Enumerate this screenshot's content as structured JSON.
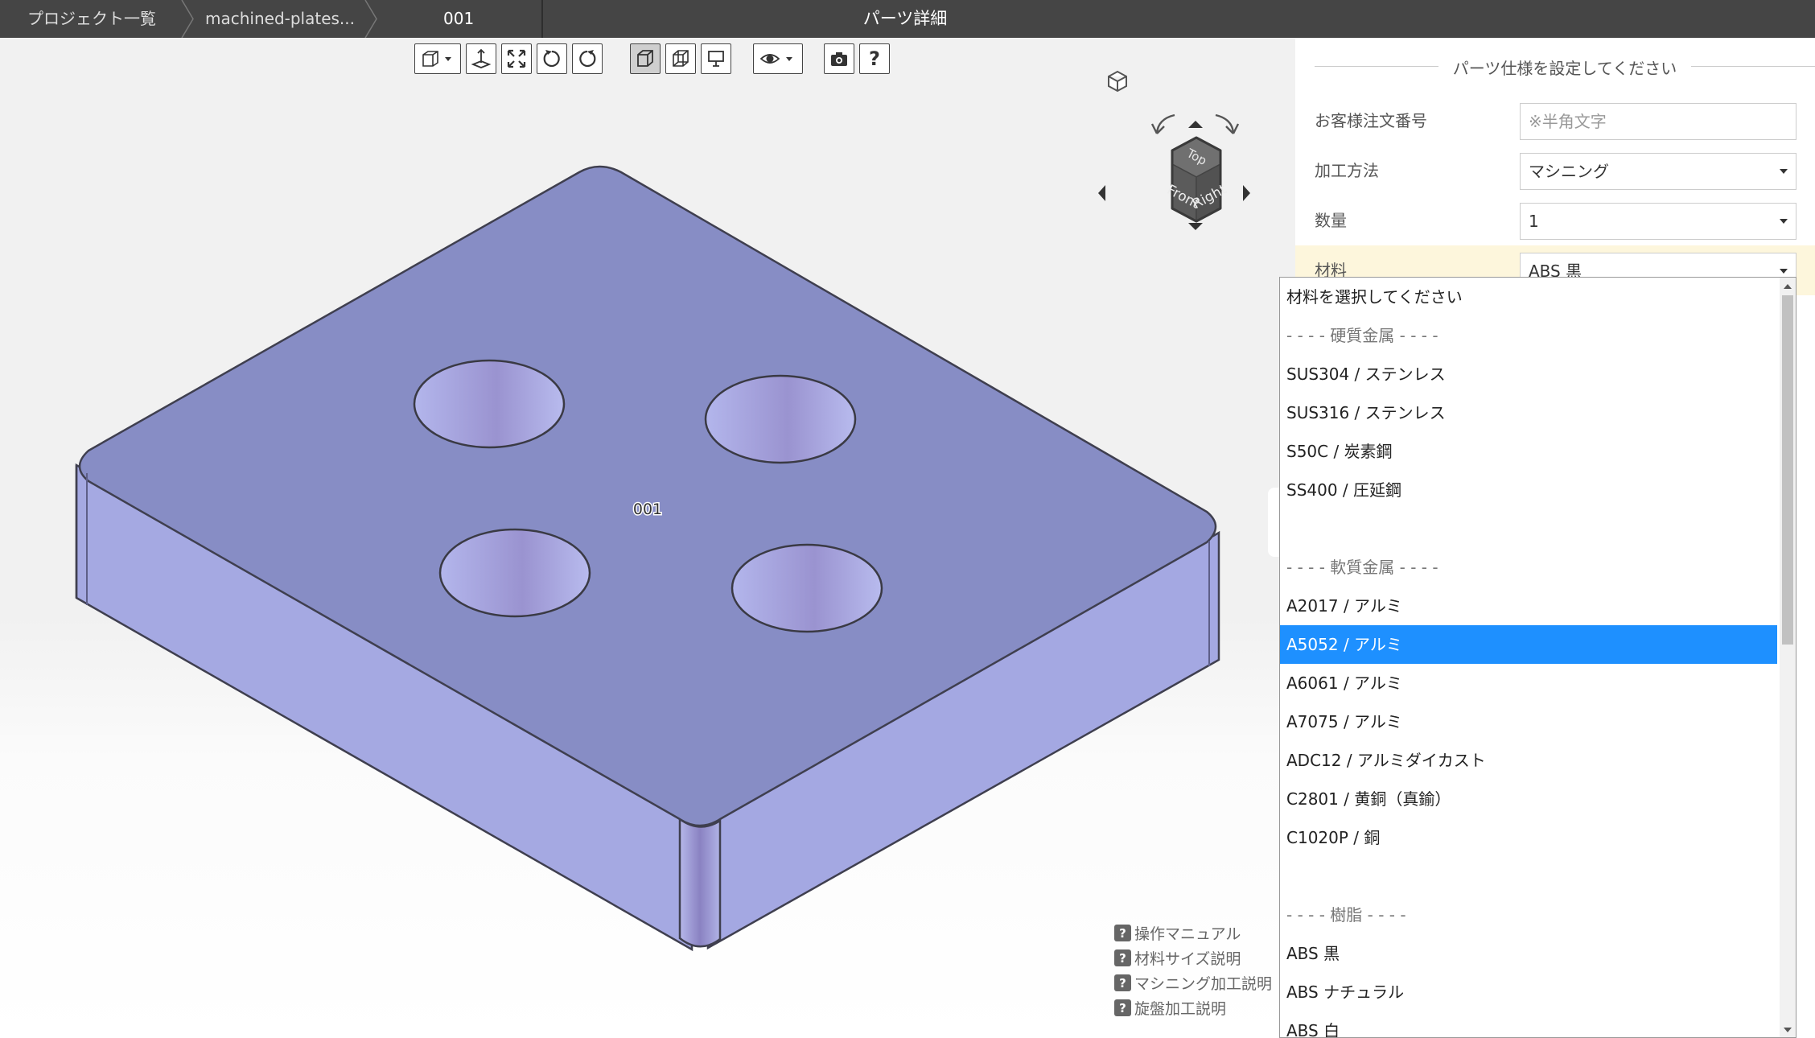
{
  "breadcrumb": {
    "items": [
      "プロジェクト一覧",
      "machined-plates...",
      "001"
    ]
  },
  "page_title": "パーツ詳細",
  "viewer": {
    "part_label": "001",
    "viewcube": {
      "top": "Top",
      "front": "Front",
      "right": "Right"
    },
    "toolbar": [
      "view-mode-dropdown",
      "fit-floor",
      "fit-all",
      "rotate-left",
      "rotate-right",
      "shaded-view",
      "wireframe-view",
      "presentation-view",
      "visibility-dropdown",
      "screenshot",
      "help"
    ],
    "help_links": [
      "操作マニュアル",
      "材料サイズ説明",
      "マシニング加工説明",
      "旋盤加工説明"
    ],
    "colors": {
      "top_face": "#878dc5",
      "side_face": "#a5a9e2",
      "hole": "#a3a7de"
    }
  },
  "panel": {
    "header": "パーツ仕様を設定してください",
    "fields": {
      "order_number": {
        "label": "お客様注文番号",
        "placeholder": "※半角文字"
      },
      "process": {
        "label": "加工方法",
        "value": "マシニング"
      },
      "quantity": {
        "label": "数量",
        "value": "1"
      },
      "material": {
        "label": "材料",
        "value": "ABS 黒"
      }
    }
  },
  "dropdown": {
    "options": [
      "材料を選択してください",
      "- - - - 硬質金属 - - - -",
      "SUS304 / ステンレス",
      "SUS316 / ステンレス",
      "S50C / 炭素鋼",
      "SS400 / 圧延鋼",
      "",
      "- - - - 軟質金属 - - - -",
      "A2017 / アルミ",
      "A5052 / アルミ",
      "A6061 / アルミ",
      "A7075 / アルミ",
      "ADC12 / アルミダイカスト",
      "C2801 / 黄銅（真鍮）",
      "C1020P / 銅",
      "",
      "- - - - 樹脂 - - - -",
      "ABS 黒",
      "ABS ナチュラル",
      "ABS 白"
    ],
    "selected": "A5052 / アルミ",
    "highlight_color": "#1e90ff"
  }
}
